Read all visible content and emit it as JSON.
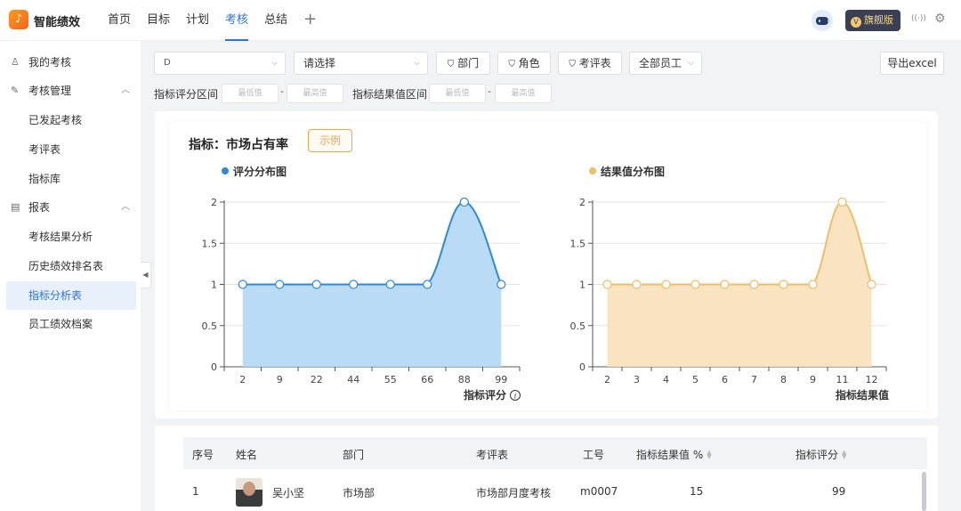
{
  "app": {
    "name": "智能绩效",
    "logo_glyph": "♪"
  },
  "nav": {
    "items": [
      {
        "label": "首页",
        "active": false
      },
      {
        "label": "目标",
        "active": false
      },
      {
        "label": "计划",
        "active": false
      },
      {
        "label": "考核",
        "active": true
      },
      {
        "label": "总结",
        "active": false
      }
    ],
    "plus_glyph": "+"
  },
  "topbar": {
    "edition_badge": "旗舰版",
    "edition_glyph": "V",
    "broadcast_glyph": "((·))",
    "gear_glyph": "⚙"
  },
  "sidebar": {
    "items": [
      {
        "label": "我的考核",
        "icon": "user-icon",
        "glyph": "♙"
      },
      {
        "label": "考核管理",
        "icon": "edit-icon",
        "glyph": "✎",
        "expanded": true
      },
      {
        "label": "已发起考核"
      },
      {
        "label": "考评表"
      },
      {
        "label": "指标库"
      },
      {
        "label": "报表",
        "icon": "report-icon",
        "glyph": "▤",
        "expanded": true
      },
      {
        "label": "考核结果分析"
      },
      {
        "label": "历史绩效排名表"
      },
      {
        "label": "指标分析表",
        "active": true
      },
      {
        "label": "员工绩效档案"
      }
    ],
    "chevron_glyph": "︿",
    "collapse_glyph": "◀"
  },
  "filters": {
    "select1_value": "D",
    "select2_value": "请选择",
    "dept_label": "部门",
    "role_label": "角色",
    "form_label": "考评表",
    "employees_label": "全部员工",
    "export_label": "导出excel",
    "filter_glyph": "⛉",
    "dropdown_glyph": "⌵",
    "score_range_label": "指标评分区间",
    "result_range_label": "指标结果值区间",
    "min_placeholder": "最低值",
    "max_placeholder": "最高值",
    "dash": "-"
  },
  "indicator": {
    "label": "指标：",
    "name": "市场占有率",
    "example_label": "示例"
  },
  "chart_data": [
    {
      "type": "area",
      "title": "评分分布图",
      "color": "#2e8ad8",
      "fill": "#b5d9f4",
      "xlabel": "指标评分",
      "x": [
        "2",
        "9",
        "22",
        "44",
        "55",
        "66",
        "88",
        "99"
      ],
      "values": [
        1,
        1,
        1,
        1,
        1,
        1,
        2,
        1
      ],
      "yticks": [
        "0",
        "0.5",
        "1",
        "1.5",
        "2"
      ],
      "ylim": [
        0,
        2
      ],
      "grid": true,
      "smooth": true
    },
    {
      "type": "area",
      "title": "结果值分布图",
      "color": "#efbe6a",
      "fill": "#fae2bd",
      "xlabel": "指标结果值",
      "x": [
        "2",
        "3",
        "4",
        "5",
        "6",
        "7",
        "8",
        "9",
        "11",
        "12"
      ],
      "values": [
        1,
        1,
        1,
        1,
        1,
        1,
        1,
        1,
        2,
        1
      ],
      "yticks": [
        "0",
        "0.5",
        "1",
        "1.5",
        "2"
      ],
      "ylim": [
        0,
        2
      ],
      "grid": true,
      "smooth": true
    }
  ],
  "table": {
    "headers": {
      "index": "序号",
      "name": "姓名",
      "dept": "部门",
      "form": "考评表",
      "emp_id": "工号",
      "result_pct": "指标结果值 %",
      "score": "指标评分"
    },
    "rows": [
      {
        "index": "1",
        "name": "吴小坚",
        "dept": "市场部",
        "form": "市场部月度考核",
        "emp_id": "m0007",
        "result_pct": "15",
        "score": "99"
      }
    ],
    "sort_glyph": "▲▼"
  }
}
